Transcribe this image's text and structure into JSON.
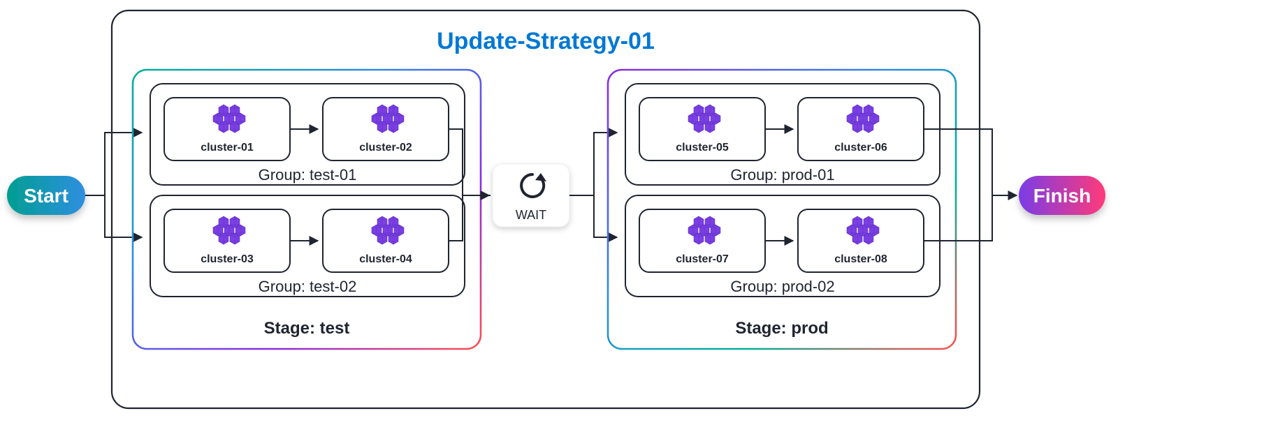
{
  "strategy": {
    "title": "Update-Strategy-01"
  },
  "pills": {
    "start": "Start",
    "finish": "Finish"
  },
  "wait": {
    "label": "WAIT"
  },
  "stages": [
    {
      "label": "Stage: test",
      "groups": [
        {
          "label": "Group: test-01",
          "clusters": [
            "cluster-01",
            "cluster-02"
          ]
        },
        {
          "label": "Group: test-02",
          "clusters": [
            "cluster-03",
            "cluster-04"
          ]
        }
      ]
    },
    {
      "label": "Stage: prod",
      "groups": [
        {
          "label": "Group: prod-01",
          "clusters": [
            "cluster-05",
            "cluster-06"
          ]
        },
        {
          "label": "Group: prod-02",
          "clusters": [
            "cluster-07",
            "cluster-08"
          ]
        }
      ]
    }
  ]
}
